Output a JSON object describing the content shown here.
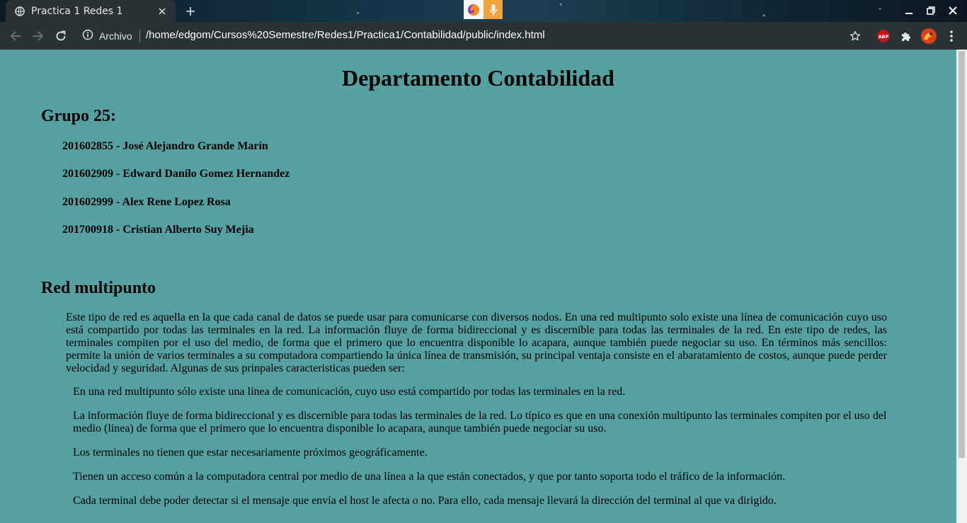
{
  "browser": {
    "tab": {
      "title": "Practica 1 Redes 1"
    },
    "address_bar": {
      "security_label": "Archivo",
      "url": "/home/edgom/Cursos%20Semestre/Redes1/Practica1/Contabilidad/public/index.html"
    },
    "extensions": {
      "adblock_label": "ABP"
    },
    "icons": [
      "globe-icon",
      "close-icon",
      "plus-icon",
      "firefox-icon",
      "microphone-icon",
      "minimize-icon",
      "restore-icon",
      "window-close-icon",
      "back-icon",
      "forward-icon",
      "reload-icon",
      "info-icon",
      "star-icon",
      "adblock-icon",
      "puzzle-icon",
      "avatar-icon",
      "menu-icon"
    ],
    "colors": {
      "frame": "#2a3235",
      "page_background": "#56a0a2",
      "adblock": "#c9141f",
      "mic": "#f5a43a"
    }
  },
  "page": {
    "title": "Departamento Contabilidad",
    "group_heading": "Grupo 25:",
    "members": [
      "201602855 - José Alejandro Grande Marín",
      "201602909 - Edward Danilo Gomez Hernandez",
      "201602999 - Alex Rene Lopez Rosa",
      "201700918 - Cristian Alberto Suy Mejia"
    ],
    "section_heading": "Red multipunto",
    "intro": "Este tipo de red es aquella en la que cada canal de datos se puede usar para comunicarse con diversos nodos. En una red multipunto solo existe una línea de comunicación cuyo uso está compartido por todas las terminales en la red. La información fluye de forma bidireccional y es discernible para todas las terminales de la red. En este tipo de redes, las terminales compiten por el uso del medio, de forma que el primero que lo encuentra disponible lo acapara, aunque también puede negociar su uso. En términos más sencillos: permite la unión de varios terminales a su computadora compartiendo la única línea de transmisión, su principal ventaja consiste en el abaratamiento de costos, aunque puede perder velocidad y seguridad. Algunas de sus prinpales caracteristicas pueden ser:",
    "points": [
      "En una red multipunto sólo existe una línea de comunicación, cuyo uso está compartido por todas las terminales en la red.",
      "La información fluye de forma bidireccional y es discernible para todas las terminales de la red. Lo típico es que en una conexión multipunto las terminales compiten por el uso del medio (línea) de forma que el primero que lo encuentra disponible lo acapara, aunque también puede negociar su uso.",
      "Los terminales no tienen que estar necesariamente próximos geográficamente.",
      "Tienen un acceso común a la computadora central por medio de una línea a la que están conectados, y que por tanto soporta todo el tráfico de la información.",
      "Cada terminal debe poder detectar si el mensaje que envía el host le afecta o no. Para ello, cada mensaje llevará la dirección del terminal al que va dirigido."
    ]
  }
}
